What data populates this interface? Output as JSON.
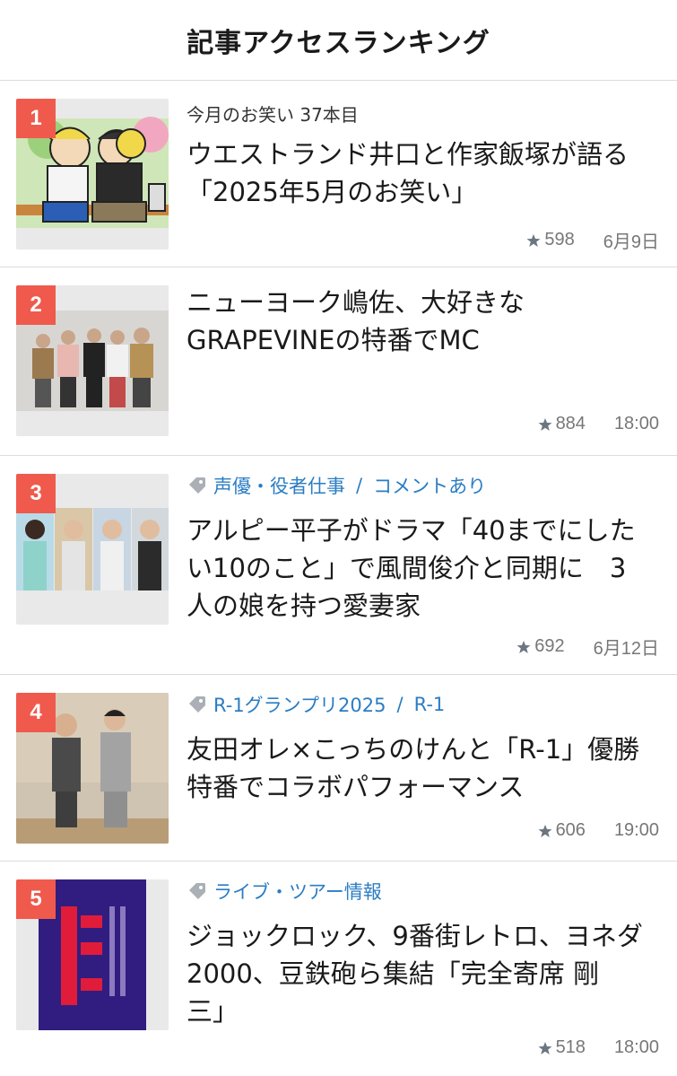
{
  "header": {
    "title": "記事アクセスランキング"
  },
  "items": [
    {
      "rank": "1",
      "kicker": "今月のお笑い 37本目",
      "title_line1": "ウエストランド井口と作家飯塚が語る",
      "title_line2": "「2025年5月のお笑い」",
      "stars": "598",
      "date": "6月9日"
    },
    {
      "rank": "2",
      "title_line1": "ニューヨーク嶋佐、大好きな",
      "title_line2": "GRAPEVINEの特番でMC",
      "stars": "884",
      "date": "18:00"
    },
    {
      "rank": "3",
      "tag1": "声優・役者仕事",
      "tag2": "コメントあり",
      "title_line1": "アルピー平子がドラマ「40までにした",
      "title_line2": "い10のこと」で風間俊介と同期に　3",
      "title_line3": "人の娘を持つ愛妻家",
      "stars": "692",
      "date": "6月12日"
    },
    {
      "rank": "4",
      "tag1": "R-1グランプリ2025",
      "tag2": "R-1",
      "title_line1": "友田オレ×こっちのけんと「R-1」優勝",
      "title_line2": "特番でコラボパフォーマンス",
      "stars": "606",
      "date": "19:00"
    },
    {
      "rank": "5",
      "tag1": "ライブ・ツアー情報",
      "title_line1": "ジョックロック、9番街レトロ、ヨネダ",
      "title_line2": "2000、豆鉄砲ら集結「完全寄席 剛",
      "title_line3": "三」",
      "stars": "518",
      "date": "18:00"
    }
  ],
  "colors": {
    "rank_badge": "#ef5a4d",
    "tag_link": "#2b7dc3",
    "divider": "#dcdcdc"
  },
  "icons": {
    "tag": "tag-icon",
    "star": "star-icon"
  }
}
